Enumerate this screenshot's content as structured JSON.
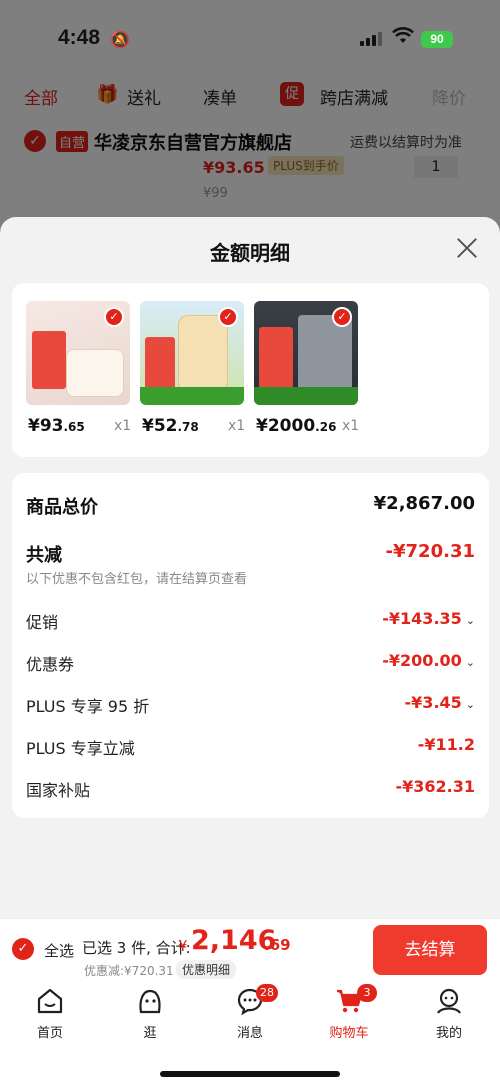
{
  "status_bar": {
    "time": "4:48",
    "battery": "90"
  },
  "background": {
    "filters": {
      "all": "全部",
      "gift": "送礼",
      "combo": "凑单",
      "promo_badge": "促",
      "cross_store": "跨店满减",
      "price": "降价"
    },
    "store": {
      "self_badge": "自营",
      "name": "华凌京东自营官方旗舰店",
      "shipping": "运费以结算时为准"
    },
    "item_price": "¥93.65",
    "plus_tag": "PLUS到手价",
    "qty": "1",
    "orig_price": "¥99"
  },
  "sheet": {
    "title": "金额明细",
    "products": [
      {
        "price_int": "¥93",
        "price_dec": ".65",
        "qty": "x1"
      },
      {
        "price_int": "¥52",
        "price_dec": ".78",
        "qty": "x1"
      },
      {
        "price_int": "¥2000",
        "price_dec": ".26",
        "qty": "x1"
      }
    ],
    "summary": {
      "total_label": "商品总价",
      "total_value": "¥2,867.00",
      "reduce_label": "共减",
      "reduce_value": "-¥720.31",
      "reduce_note": "以下优惠不包含红包，请在结算页查看",
      "promo_label": "促销",
      "promo_value": "-¥143.35",
      "coupon_label": "优惠券",
      "coupon_value": "-¥200.00",
      "plus95_label": "PLUS 专享 95 折",
      "plus95_value": "-¥3.45",
      "plusoff_label": "PLUS 专享立减",
      "plusoff_value": "-¥11.2",
      "subsidy_label": "国家补贴",
      "subsidy_value": "-¥362.31"
    }
  },
  "checkout": {
    "select_all": "全选",
    "selected": "已选 3 件, 合计:",
    "currency": "¥",
    "amount": "2,146",
    "cents": ".69",
    "saved": "优惠减:¥720.31",
    "detail": "优惠明细",
    "button": "去结算"
  },
  "tabbar": {
    "home": "首页",
    "browse": "逛",
    "messages": "消息",
    "messages_badge": "28",
    "cart": "购物车",
    "cart_badge": "3",
    "me": "我的"
  },
  "colors": {
    "accent": "#e2231a",
    "button": "#ef3a2e",
    "check": "#e2231a"
  }
}
